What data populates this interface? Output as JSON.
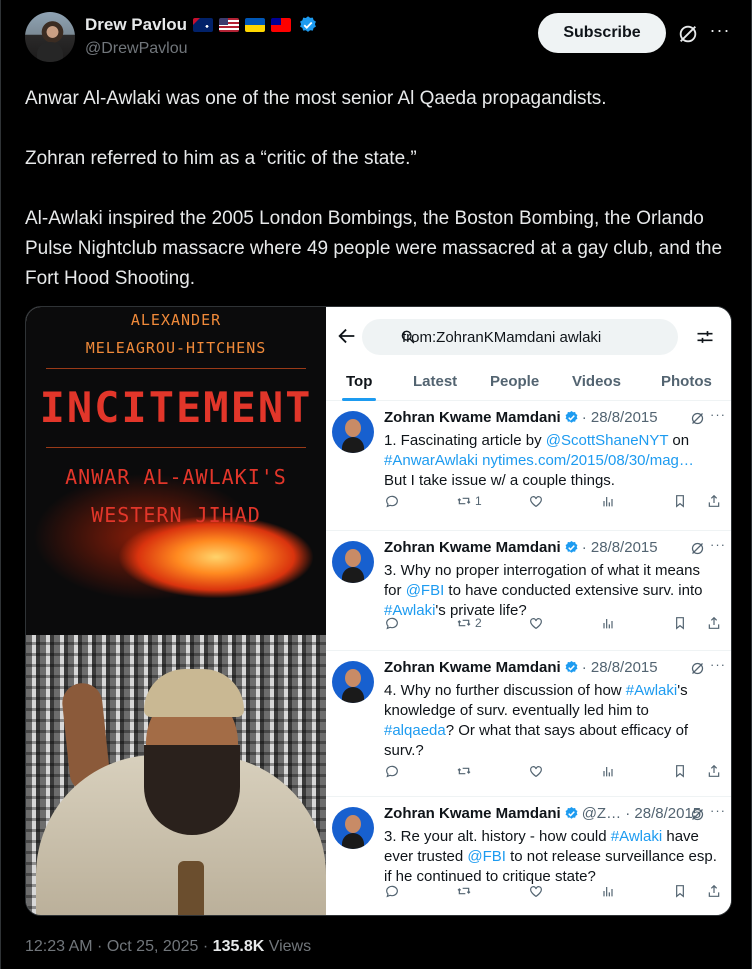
{
  "author": {
    "name": "Drew Pavlou",
    "handle": "@DrewPavlou",
    "flags": [
      "australia-flag",
      "usa-flag",
      "ukraine-flag",
      "taiwan-flag"
    ]
  },
  "actions": {
    "subscribe_label": "Subscribe"
  },
  "tweet": {
    "text": "Anwar Al-Awlaki was one of the most senior Al Qaeda propagandists.\n\nZohran referred to him as a “critic of the state.”\n\nAl-Awlaki inspired the 2005 London Bombings, the Boston Bombing, the Orlando Pulse Nightclub massacre where 49 people were massacred at a gay club, and the Fort Hood Shooting."
  },
  "book": {
    "author_line1": "ALEXANDER",
    "author_line2": "MELEAGROU-HITCHENS",
    "title": "INCITEMENT",
    "subtitle_line1": "ANWAR AL-AWLAKI'S",
    "subtitle_line2": "WESTERN JIHAD"
  },
  "search": {
    "query": "from:ZohranKMamdani awlaki",
    "tabs": [
      "Top",
      "Latest",
      "People",
      "Videos",
      "Photos"
    ],
    "active_tab": "Top",
    "results": [
      {
        "name": "Zohran Kwame Mamdani",
        "meta": "· 28/8/2015",
        "segments": [
          [
            "1. Fascinating article by ",
            ""
          ],
          [
            "@ScottShaneNYT",
            "hl"
          ],
          [
            " on\n",
            ""
          ],
          [
            "#AnwarAwlaki nytimes.com/2015/08/30/mag…",
            "hl"
          ],
          [
            "\nBut I take issue w/ a couple things.",
            ""
          ]
        ],
        "retweets": "1"
      },
      {
        "name": "Zohran Kwame Mamdani",
        "meta": "· 28/8/2015",
        "segments": [
          [
            "3. Why no proper interrogation of what it means\nfor ",
            ""
          ],
          [
            "@FBI",
            "hl"
          ],
          [
            " to have conducted extensive surv. into\n",
            ""
          ],
          [
            "#Awlaki",
            "hl"
          ],
          [
            "'s private life?",
            ""
          ]
        ],
        "retweets": "2"
      },
      {
        "name": "Zohran Kwame Mamdani",
        "meta": "· 28/8/2015",
        "segments": [
          [
            "4. Why no further discussion of how ",
            ""
          ],
          [
            "#Awlaki",
            "hl"
          ],
          [
            "'s\nknowledge of surv. eventually led him to\n",
            ""
          ],
          [
            "#alqaeda",
            "hl"
          ],
          [
            "? Or what that says about efficacy of\nsurv.?",
            ""
          ]
        ],
        "retweets": ""
      },
      {
        "name": "Zohran Kwame Mamdani",
        "meta": "@Z… · 28/8/2015",
        "segments": [
          [
            "3. Re your alt. history - how could ",
            ""
          ],
          [
            "#Awlaki",
            "hl"
          ],
          [
            " have\never trusted ",
            ""
          ],
          [
            "@FBI",
            "hl"
          ],
          [
            " to not release surveillance esp.\nif he continued to critique state?",
            ""
          ]
        ],
        "retweets": ""
      }
    ]
  },
  "footer": {
    "time": "12:23 AM",
    "date": "Oct 25, 2025",
    "views_count": "135.8K",
    "views_label": "Views"
  }
}
